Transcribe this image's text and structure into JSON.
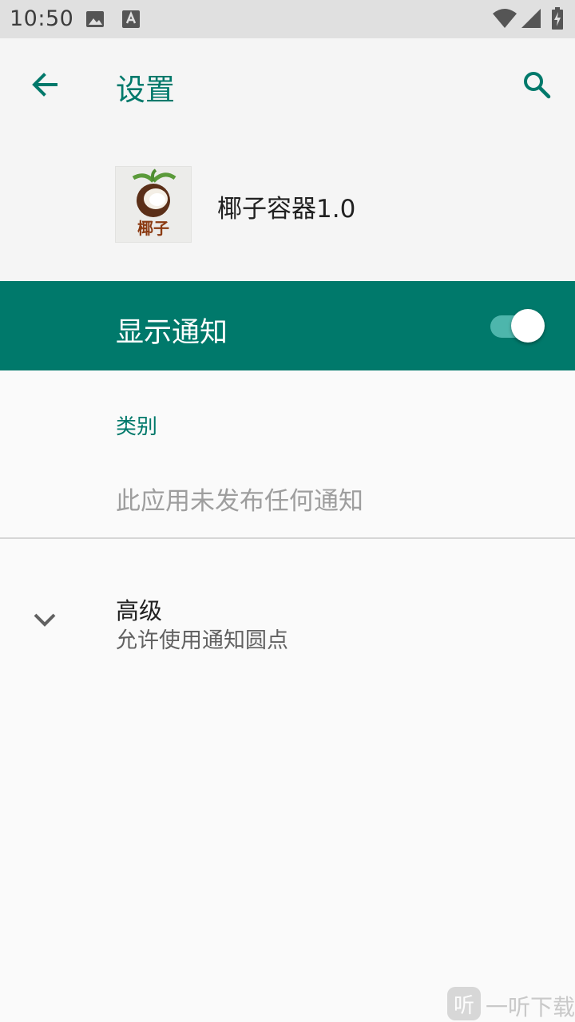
{
  "status_bar": {
    "time": "10:50",
    "icons": [
      "image-icon",
      "keyboard-a-icon",
      "wifi-icon",
      "signal-icon",
      "battery-charging-icon"
    ]
  },
  "app_bar": {
    "title": "设置",
    "back_icon": "arrow-back-icon",
    "search_icon": "search-icon"
  },
  "app_info": {
    "name": "椰子容器1.0",
    "icon_text": "椰子"
  },
  "notifications": {
    "toggle_label": "显示通知",
    "enabled": true
  },
  "category": {
    "header": "类别",
    "empty_text": "此应用未发布任何通知"
  },
  "advanced": {
    "title": "高级",
    "summary": "允许使用通知圆点",
    "icon": "chevron-down-icon"
  },
  "watermark": {
    "badge": "听",
    "text": "一听下载"
  },
  "colors": {
    "accent": "#00796b",
    "toggle_track": "#4db6ac",
    "background": "#fafafa",
    "status_bar": "#e0e0e0"
  }
}
